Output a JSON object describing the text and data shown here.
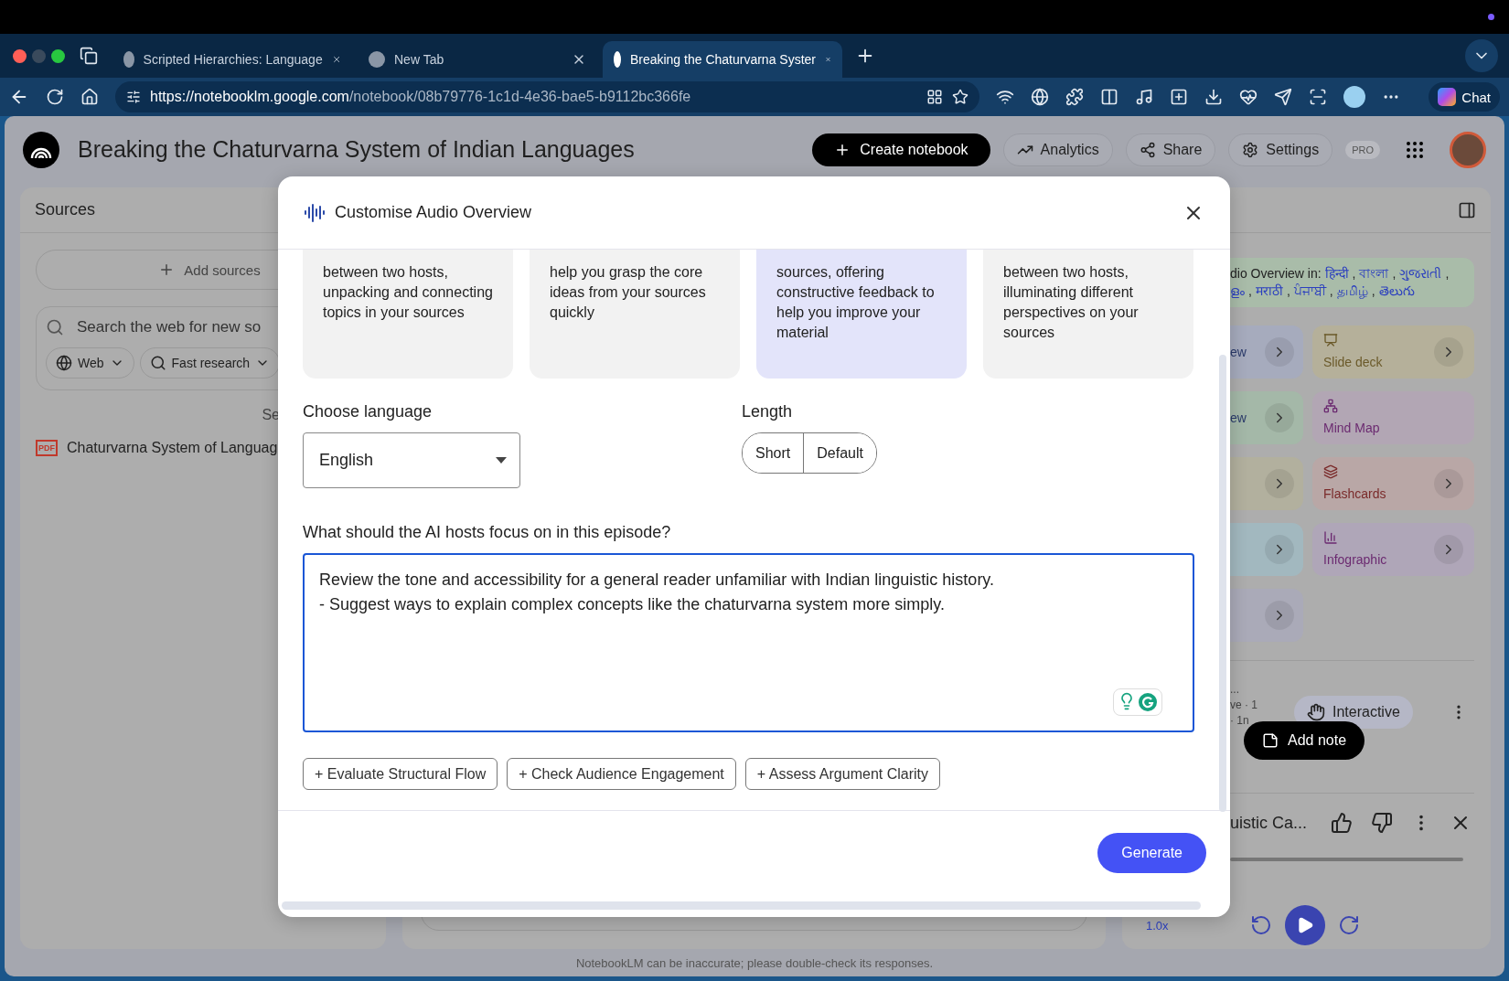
{
  "browser": {
    "tabs": [
      {
        "title": "Scripted Hierarchies: Language",
        "selected": false
      },
      {
        "title": "New Tab",
        "selected": false
      },
      {
        "title": "Breaking the Chaturvarna Syster",
        "selected": true
      }
    ],
    "url": {
      "host": "https://notebooklm.google.com",
      "path": "/notebook/08b79776-1c1d-4e36-bae5-b9112bc366fe"
    },
    "chat_button": "Chat"
  },
  "header": {
    "title": "Breaking the Chaturvarna System of Indian Languages",
    "create_button": "Create notebook",
    "actions": [
      {
        "label": "Analytics",
        "kind": "analytics"
      },
      {
        "label": "Share",
        "kind": "share"
      },
      {
        "label": "Settings",
        "kind": "settings"
      }
    ],
    "badge": "PRO"
  },
  "sources": {
    "title": "Sources",
    "add_button": "Add sources",
    "search_placeholder": "Search the web for new so",
    "chips": [
      {
        "label": "Web",
        "kind": "web"
      },
      {
        "label": "Fast research",
        "kind": "research"
      }
    ],
    "select_all": "Se",
    "items": [
      {
        "name": "Chaturvarna System of Languag",
        "type": "PDF"
      }
    ]
  },
  "studio": {
    "banner": [
      [
        {
          "text": "dio Overview in:",
          "kind": "lead"
        },
        {
          "text": "हिन्दी",
          "kind": "link"
        },
        {
          "text": ",",
          "kind": "sep"
        },
        {
          "text": "বাংলা",
          "kind": "link"
        },
        {
          "text": ",",
          "kind": "sep"
        },
        {
          "text": "ગુજરાતી",
          "kind": "link"
        },
        {
          "text": ",",
          "kind": "sep"
        }
      ],
      [
        {
          "text": "ളം",
          "kind": "link"
        },
        {
          "text": ",",
          "kind": "sep"
        },
        {
          "text": "मराठी",
          "kind": "link"
        },
        {
          "text": ",",
          "kind": "sep"
        },
        {
          "text": "ਪੰਜਾਬੀ",
          "kind": "link"
        },
        {
          "text": ",",
          "kind": "sep"
        },
        {
          "text": "தமிழ்",
          "kind": "link"
        },
        {
          "text": ",",
          "kind": "sep"
        },
        {
          "text": "తెలుగు",
          "kind": "link"
        }
      ]
    ],
    "tools_left": [
      {
        "label": "ew",
        "color": "#a6abbd"
      },
      {
        "label": "ew",
        "color": "#a4b8a8"
      },
      {
        "color": "#b2b09e"
      },
      {
        "color": "#a2b8bf"
      },
      {
        "color": "#aaaab8"
      }
    ],
    "tools_right": [
      {
        "label": "Slide deck",
        "kind": "slides",
        "color": "#b5b09a"
      },
      {
        "label": "Mind Map",
        "kind": "mindmap",
        "color": "#b2a6b4"
      },
      {
        "label": "Flashcards",
        "kind": "flashcards",
        "color": "#b9a7a6"
      },
      {
        "label": "Infographic",
        "kind": "infographic",
        "color": "#afa6b8"
      }
    ],
    "note": {
      "lines": [
        "...",
        "ve · 1",
        "· 1n"
      ],
      "interactive": "Interactive"
    },
    "add_note": "Add note",
    "player": {
      "title": "uistic Ca...",
      "speed": "1.0x"
    }
  },
  "modal": {
    "title": "Customise Audio Overview",
    "formats": [
      {
        "text": "between two hosts,\nunpacking and connecting\ntopics in your sources",
        "selected": false
      },
      {
        "text": "help you grasp the core\nideas from your sources\nquickly",
        "selected": false
      },
      {
        "text": "sources, offering\nconstructive feedback to\nhelp you improve your\nmaterial",
        "selected": true
      },
      {
        "text": "between two hosts,\nilluminating different\nperspectives on your\nsources",
        "selected": false
      }
    ],
    "language": {
      "label": "Choose language",
      "value": "English"
    },
    "length": {
      "label": "Length",
      "options": [
        {
          "label": "Short",
          "selected": false
        },
        {
          "label": "Default",
          "selected": false
        }
      ]
    },
    "focus": {
      "label": "What should the AI hosts focus on in this episode?",
      "value": "Review the tone and accessibility for a general reader unfamiliar with Indian linguistic history.\n- Suggest ways to explain complex concepts like the chaturvarna system more simply."
    },
    "suggestions": [
      "+ Evaluate Structural Flow",
      "+ Check Audience Engagement",
      "+ Assess Argument Clarity"
    ],
    "generate": "Generate"
  },
  "footer": "NotebookLM can be inaccurate; please double-check its responses."
}
